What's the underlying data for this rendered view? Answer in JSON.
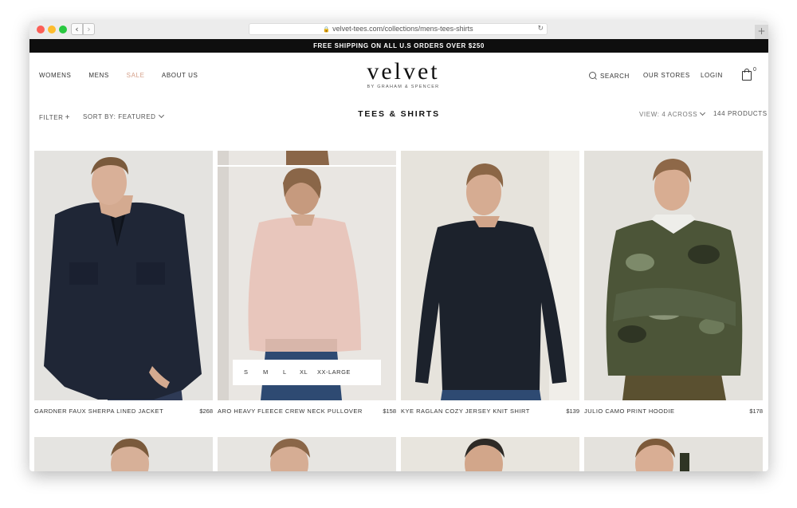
{
  "browser": {
    "url": "velvet-tees.com/collections/mens-tees-shirts",
    "back_glyph": "‹",
    "forward_glyph": "›",
    "reload_glyph": "↻",
    "newtab_glyph": "+",
    "lock_glyph": "🔒"
  },
  "announcement": "FREE SHIPPING ON ALL U.S ORDERS OVER $250",
  "nav_left": {
    "womens": "WOMENS",
    "mens": "MENS",
    "sale": "SALE",
    "about": "ABOUT US"
  },
  "logo": {
    "word": "velvet",
    "sub": "BY GRAHAM & SPENCER"
  },
  "nav_right": {
    "search": "SEARCH",
    "stores": "OUR STORES",
    "login": "LOGIN",
    "cart_count": "0"
  },
  "toolbar": {
    "filter": "FILTER",
    "filter_plus": "+",
    "sort": "SORT BY: FEATURED",
    "view": "VIEW: 4 ACROSS",
    "count": "144 PRODUCTS"
  },
  "page_title": "TEES & SHIRTS",
  "products": [
    {
      "name": "GARDNER FAUX SHERPA LINED JACKET",
      "price": "$268"
    },
    {
      "name": "ARO HEAVY FLEECE CREW NECK PULLOVER",
      "price": "$158"
    },
    {
      "name": "KYE RAGLAN COZY JERSEY KNIT SHIRT",
      "price": "$139"
    },
    {
      "name": "JULIO CAMO PRINT HOODIE",
      "price": "$178"
    }
  ],
  "sizes": [
    "S",
    "M",
    "L",
    "XL",
    "XX-LARGE"
  ],
  "colors": {
    "sale": "#d4a08a",
    "announce_bg": "#0e0e0e",
    "jacket": "#1f2636",
    "pullover": "#e8c6bc",
    "shirt": "#1c222c",
    "camo": "#4c5538"
  }
}
